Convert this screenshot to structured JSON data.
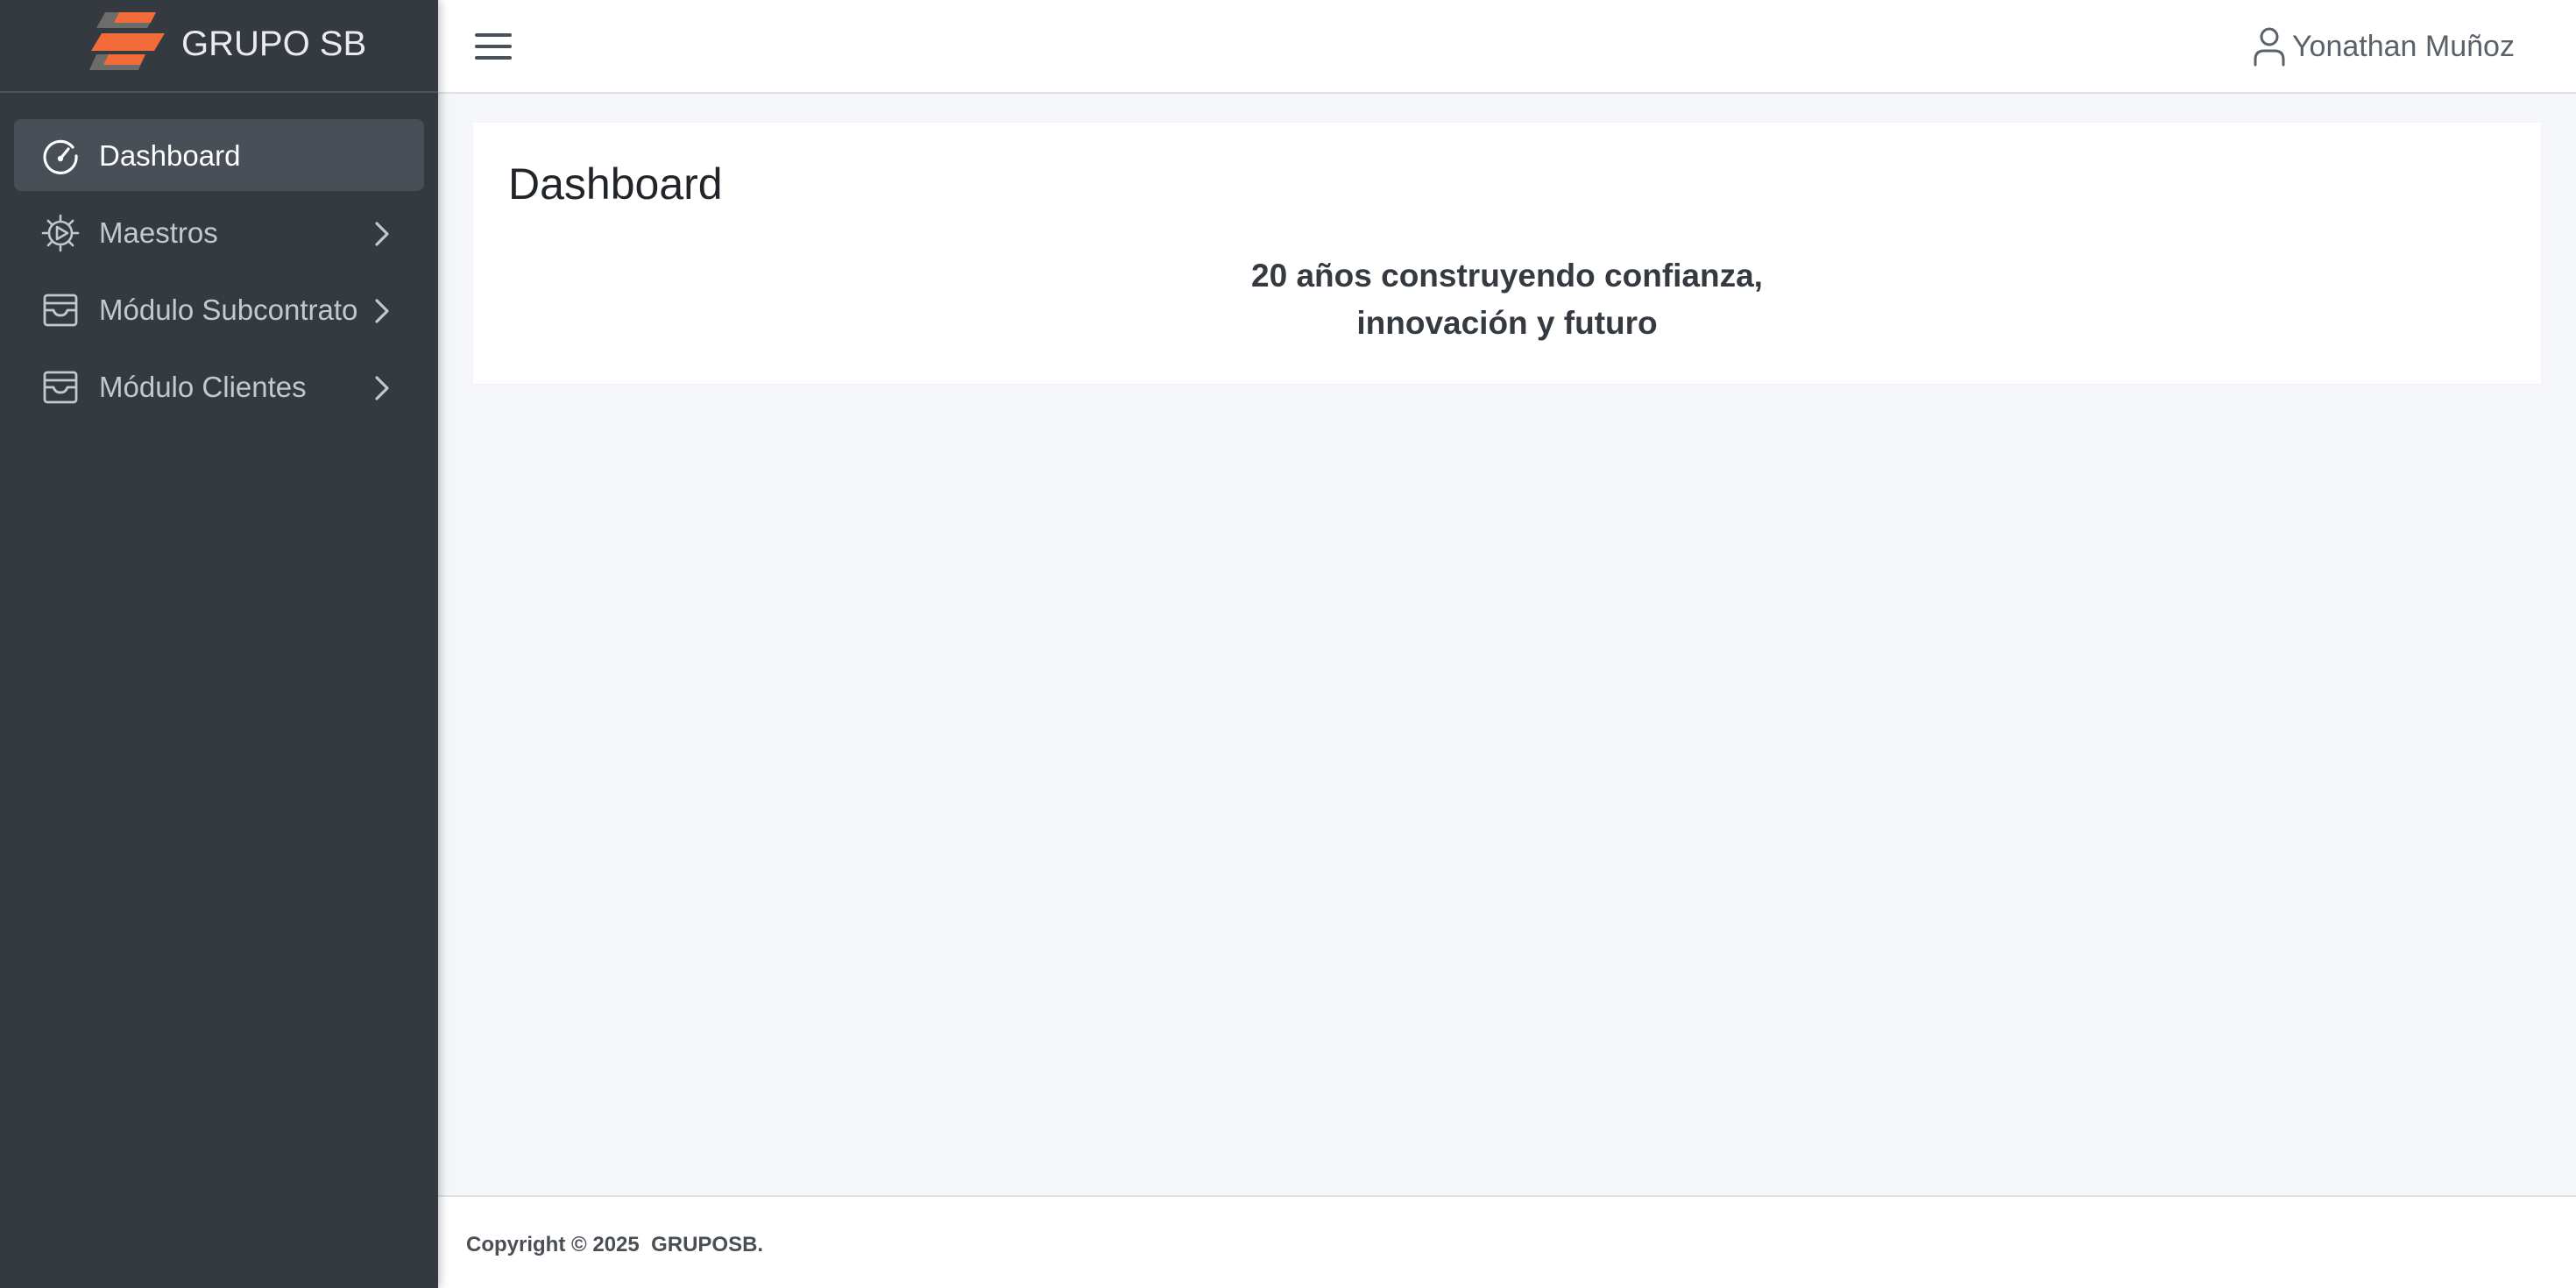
{
  "brand": {
    "name": "GRUPO SB",
    "logo_icon": "grupo-sb-logo",
    "logo_colors": [
      "#f26b38",
      "#6c6c6c"
    ]
  },
  "sidebar": {
    "items": [
      {
        "label": "Dashboard",
        "icon": "speedometer-icon",
        "active": true,
        "has_submenu": false
      },
      {
        "label": "Maestros",
        "icon": "gear-play-icon",
        "active": false,
        "has_submenu": true
      },
      {
        "label": "Módulo Subcontrato",
        "icon": "inbox-icon",
        "active": false,
        "has_submenu": true
      },
      {
        "label": "Módulo Clientes",
        "icon": "inbox-icon",
        "active": false,
        "has_submenu": true
      }
    ]
  },
  "header": {
    "menu_icon": "hamburger-icon",
    "user_icon": "person-icon",
    "user_name": "Yonathan Muñoz"
  },
  "main": {
    "title": "Dashboard",
    "tagline_line1": "20 años construyendo confianza,",
    "tagline_line2": "innovación y futuro"
  },
  "footer": {
    "copyright": "Copyright © 2025  GRUPOSB."
  },
  "colors": {
    "sidebar_bg": "#343a40",
    "sidebar_active_bg": "#494f56",
    "content_bg": "#f4f6f9",
    "accent_orange": "#f26b38"
  }
}
